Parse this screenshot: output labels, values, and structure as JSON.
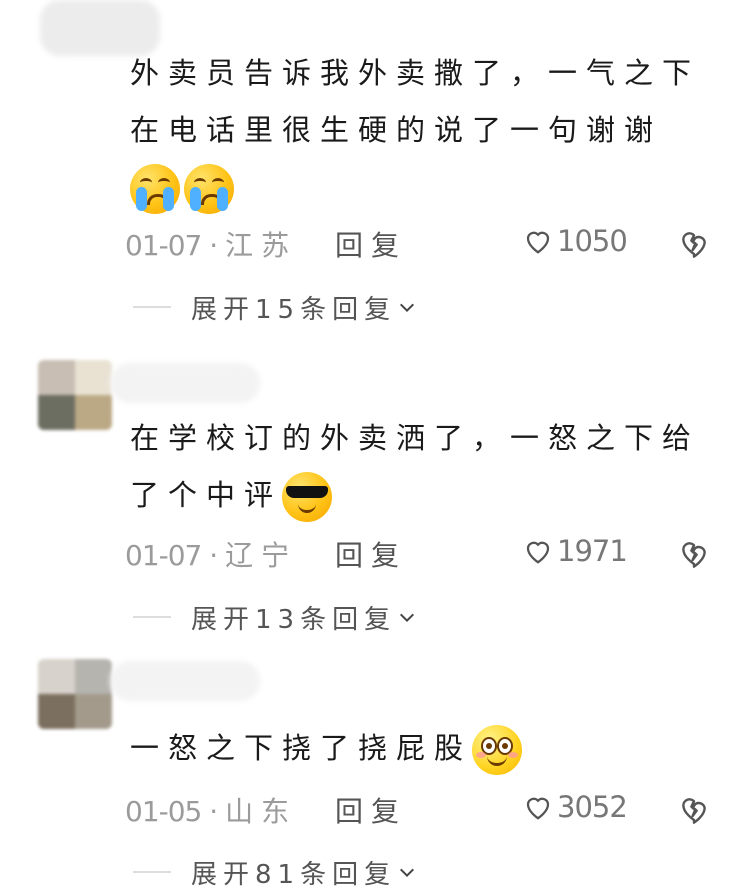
{
  "comments": [
    {
      "text_lines": [
        "外卖员告诉我外卖撒了，一气之下",
        "在电话里很生硬的说了一句谢谢"
      ],
      "emoji": [
        "crying-face",
        "crying-face"
      ],
      "date": "01-07",
      "location": "江苏",
      "reply_label": "回复",
      "likes": "1050",
      "expand_label": "展开15条回复"
    },
    {
      "text_lines": [
        "在学校订的外卖洒了，一怒之下给",
        "了个中评"
      ],
      "emoji": [
        "cool-face"
      ],
      "date": "01-07",
      "location": "辽宁",
      "reply_label": "回复",
      "likes": "1971",
      "expand_label": "展开13条回复"
    },
    {
      "text_lines": [
        "一怒之下挠了挠屁股"
      ],
      "emoji": [
        "smiling-face"
      ],
      "date": "01-05",
      "location": "山东",
      "reply_label": "回复",
      "likes": "3052",
      "expand_label": "展开81条回复"
    }
  ],
  "colors": {
    "text": "#1a1a1a",
    "meta": "#9b9b9b",
    "reply": "#555555",
    "divider": "#dddddd"
  }
}
